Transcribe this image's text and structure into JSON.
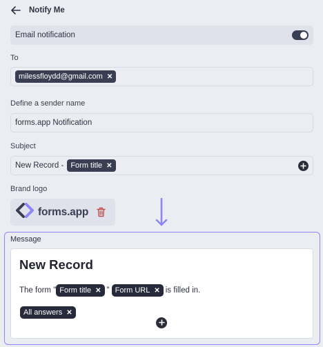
{
  "header": {
    "title": "Notify Me"
  },
  "email_toggle": {
    "label": "Email notification",
    "enabled": true
  },
  "to_field": {
    "label": "To",
    "recipients": [
      "milessfloydd@gmail.com"
    ]
  },
  "sender_field": {
    "label": "Define a sender name",
    "value": "forms.app Notification"
  },
  "subject_field": {
    "label": "Subject",
    "prefix": "New Record -",
    "tag": "Form title"
  },
  "brand_logo": {
    "label": "Brand logo",
    "logo_text": "forms.app"
  },
  "message": {
    "label": "Message",
    "heading": "New Record",
    "line_prefix": "The form \"",
    "tag_form_title": "Form title",
    "quote_close": "\"",
    "tag_form_url": "Form URL",
    "line_suffix": "is filled in.",
    "tag_all_answers": "All answers"
  },
  "colors": {
    "accent": "#8d86f5",
    "chip": "#3a3e52",
    "trash": "#c0504d",
    "background": "#ebedf3"
  }
}
